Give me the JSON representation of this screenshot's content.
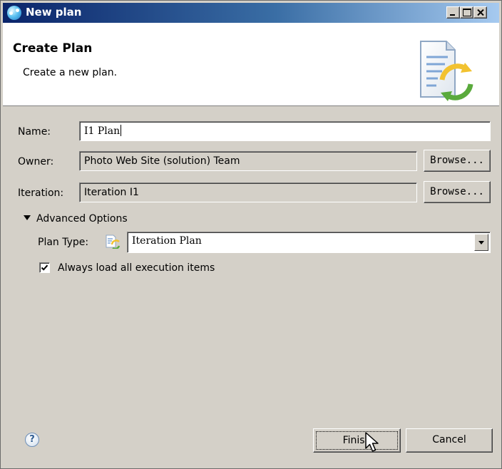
{
  "window": {
    "title": "New plan",
    "controls": {
      "minimize": "minimize",
      "maximize": "maximize",
      "close": "close"
    }
  },
  "header": {
    "title": "Create Plan",
    "description": "Create a new plan."
  },
  "form": {
    "name": {
      "label": "Name:",
      "value": "I1 Plan"
    },
    "owner": {
      "label": "Owner:",
      "value": "Photo Web Site (solution) Team",
      "browse_label": "Browse..."
    },
    "iteration": {
      "label": "Iteration:",
      "value": "Iteration I1",
      "browse_label": "Browse..."
    }
  },
  "advanced": {
    "toggle_label": "Advanced Options",
    "expanded": true,
    "plan_type": {
      "label": "Plan Type:",
      "selected": "Iteration Plan"
    },
    "load_all": {
      "label": "Always load all execution items",
      "checked": true
    }
  },
  "footer": {
    "help": "?",
    "finish_label": "Finish",
    "cancel_label": "Cancel"
  },
  "colors": {
    "title_bar_start": "#0a246a",
    "title_bar_end": "#a6caf0",
    "dialog_bg": "#d4d0c8",
    "header_bg": "#ffffff"
  },
  "icons": {
    "app": "plan-app-icon",
    "header_art": "plan-sync-document-icon",
    "plan_type": "iteration-plan-icon",
    "help": "help-icon",
    "cursor": "mouse-pointer-icon"
  }
}
